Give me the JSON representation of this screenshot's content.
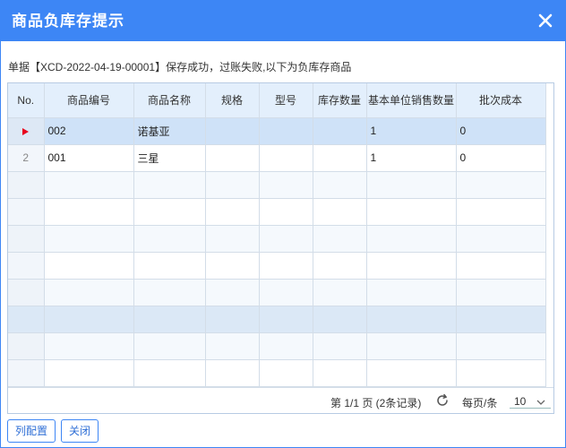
{
  "dialog": {
    "title": "商品负库存提示",
    "message": "单据【XCD-2022-04-19-00001】保存成功，过账失败,以下为负库存商品"
  },
  "table": {
    "columns": [
      "No.",
      "商品编号",
      "商品名称",
      "规格",
      "型号",
      "库存数量",
      "基本单位销售数量",
      "批次成本"
    ],
    "rows": [
      {
        "no": "",
        "code": "002",
        "name": "诺基亚",
        "spec": "",
        "model": "",
        "stock": "",
        "qty": "1",
        "cost": "0"
      },
      {
        "no": "2",
        "code": "001",
        "name": "三星",
        "spec": "",
        "model": "",
        "stock": "",
        "qty": "1",
        "cost": "0"
      }
    ]
  },
  "pager": {
    "info": "第 1/1 页 (2条记录)",
    "per_page_label": "每页/条",
    "per_page_value": "10"
  },
  "buttons": {
    "columns_config": "列配置",
    "close": "关闭"
  },
  "icons": {
    "close": "close-icon",
    "refresh": "refresh-icon",
    "current_row": "current-row-arrow-icon",
    "dropdown": "chevron-down-icon"
  },
  "colors": {
    "accent": "#3d86f5",
    "selected_row": "#cfe2f8",
    "row_marker": "#e8001c"
  }
}
